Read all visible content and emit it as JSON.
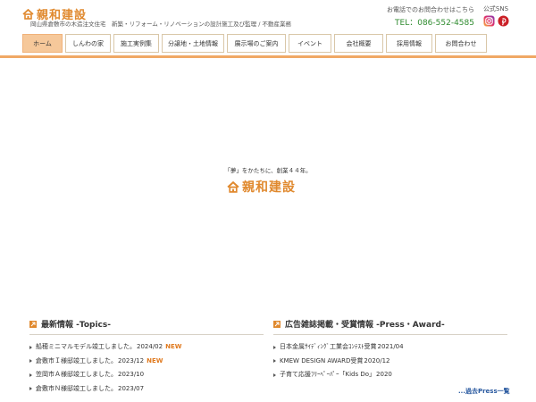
{
  "header": {
    "logo_text": "親和建設",
    "tagline": "岡山県倉敷市の木造注文住宅　新築・リフォーム・リノベーションの設計施工及び監理 / 不動産業務",
    "contact_label": "お電話でのお問合わせはこちら",
    "phone": "TEL：086-552-4585",
    "sns_label": "公式SNS",
    "sns_icons": [
      "instagram-icon",
      "pinterest-icon"
    ]
  },
  "nav": {
    "items": [
      {
        "label": "ホーム",
        "active": true
      },
      {
        "label": "しんわの家",
        "active": false
      },
      {
        "label": "施工実例集",
        "active": false
      },
      {
        "label": "分譲地・土地情報",
        "active": false
      },
      {
        "label": "展示場のご案内",
        "active": false
      },
      {
        "label": "イベント",
        "active": false
      },
      {
        "label": "会社概要",
        "active": false
      },
      {
        "label": "採用情報",
        "active": false
      },
      {
        "label": "お問合わせ",
        "active": false
      }
    ]
  },
  "hero": {
    "tagline": "「夢」をかたちに、創業４４年。",
    "logo_text": "親和建設"
  },
  "topics": {
    "title": "最新情報 -Topics-",
    "items": [
      {
        "text": "船穂ミニマルモデル竣工しました。",
        "date": "2024/02",
        "badge": "NEW"
      },
      {
        "text": "倉敷市Ｉ様邸竣工しました。",
        "date": "2023/12",
        "badge": "NEW"
      },
      {
        "text": "笠岡市Ａ様邸竣工しました。",
        "date": "2023/10",
        "badge": ""
      },
      {
        "text": "倉敷市Ｎ様邸竣工しました。",
        "date": "2023/07",
        "badge": ""
      }
    ]
  },
  "press": {
    "title": "広告雑誌掲載・受賞情報 -Press・Award-",
    "items": [
      {
        "text": "日本金属ｻｲﾃﾞｨﾝｸﾞ工業会ｺﾝﾃｽﾄ受賞",
        "date": "2021/04"
      },
      {
        "text": "KMEW DESIGN AWARD受賞",
        "date": "2020/12"
      },
      {
        "text": "子育て応援ﾌﾘｰﾍﾟｰﾊﾟｰ「Kids Do」",
        "date": "2020"
      }
    ],
    "more_label": "...過去Press一覧"
  },
  "colors": {
    "brand_orange": "#e0892e",
    "nav_active": "#f6c89a",
    "accent_bar": "#f0a865",
    "phone_green": "#2e8b2e",
    "new_badge": "#e07a1f"
  }
}
